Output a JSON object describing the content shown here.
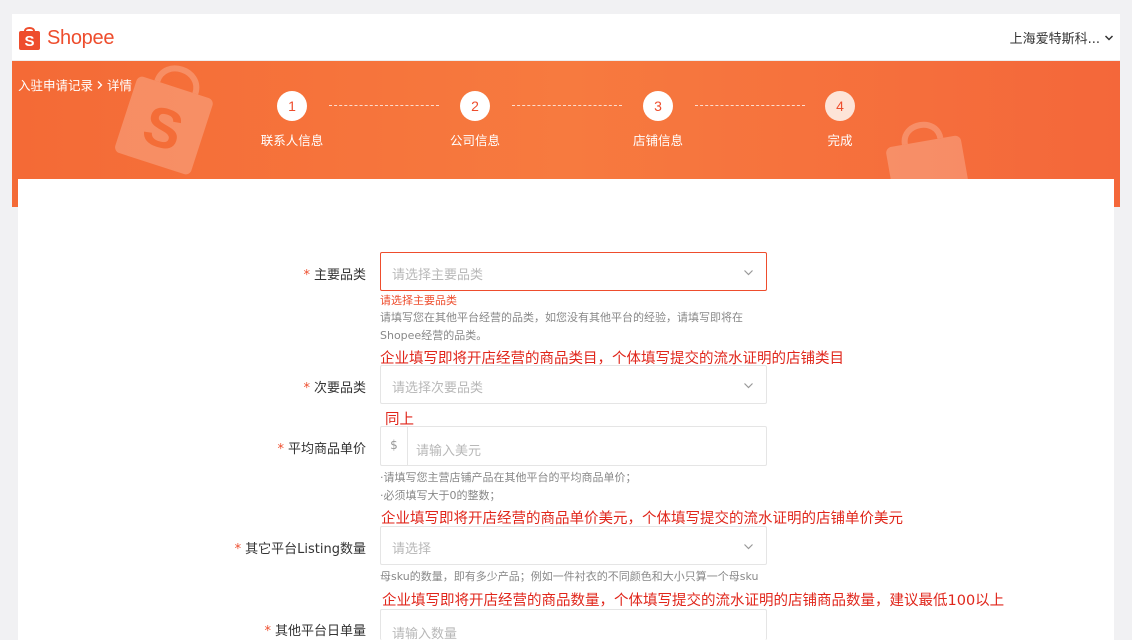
{
  "header": {
    "logo_text": "Shopee",
    "account_name": "上海爱特斯科..."
  },
  "breadcrumb": {
    "parent": "入驻申请记录",
    "current": "详情"
  },
  "steps": [
    {
      "number": "1",
      "label": "联系人信息"
    },
    {
      "number": "2",
      "label": "公司信息"
    },
    {
      "number": "3",
      "label": "店铺信息"
    },
    {
      "number": "4",
      "label": "完成"
    }
  ],
  "form": {
    "required_mark": "*",
    "main_category": {
      "label": "主要品类",
      "placeholder": "请选择主要品类",
      "error": "请选择主要品类",
      "hint_line1": "请填写您在其他平台经营的品类，如您没有其他平台的经验，请填写即将在",
      "hint_line2": "Shopee经营的品类。"
    },
    "secondary_category": {
      "label": "次要品类",
      "placeholder": "请选择次要品类"
    },
    "avg_price": {
      "label": "平均商品单价",
      "prefix": "$",
      "placeholder": "请输入美元",
      "hint_line1": "·请填写您主营店铺产品在其他平台的平均商品单价；",
      "hint_line2": "·必须填写大于0的整数；"
    },
    "listing_count": {
      "label": "其它平台Listing数量",
      "placeholder": "请选择",
      "hint": "母sku的数量，即有多少产品；例如一件衬衣的不同颜色和大小只算一个母sku"
    },
    "daily_orders": {
      "label": "其他平台日单量",
      "placeholder": "请输入数量"
    }
  },
  "annotations": {
    "note1": "企业填写即将开店经营的商品类目，个体填写提交的流水证明的店铺类目",
    "note2": "同上",
    "note3": "企业填写即将开店经营的商品单价美元，个体填写提交的流水证明的店铺单价美元",
    "note4": "企业填写即将开店经营的商品数量，个体填写提交的流水证明的店铺商品数量，建议最低100以上"
  },
  "colors": {
    "brand": "#ee4d2d",
    "annotation_red": "#e0261b"
  }
}
